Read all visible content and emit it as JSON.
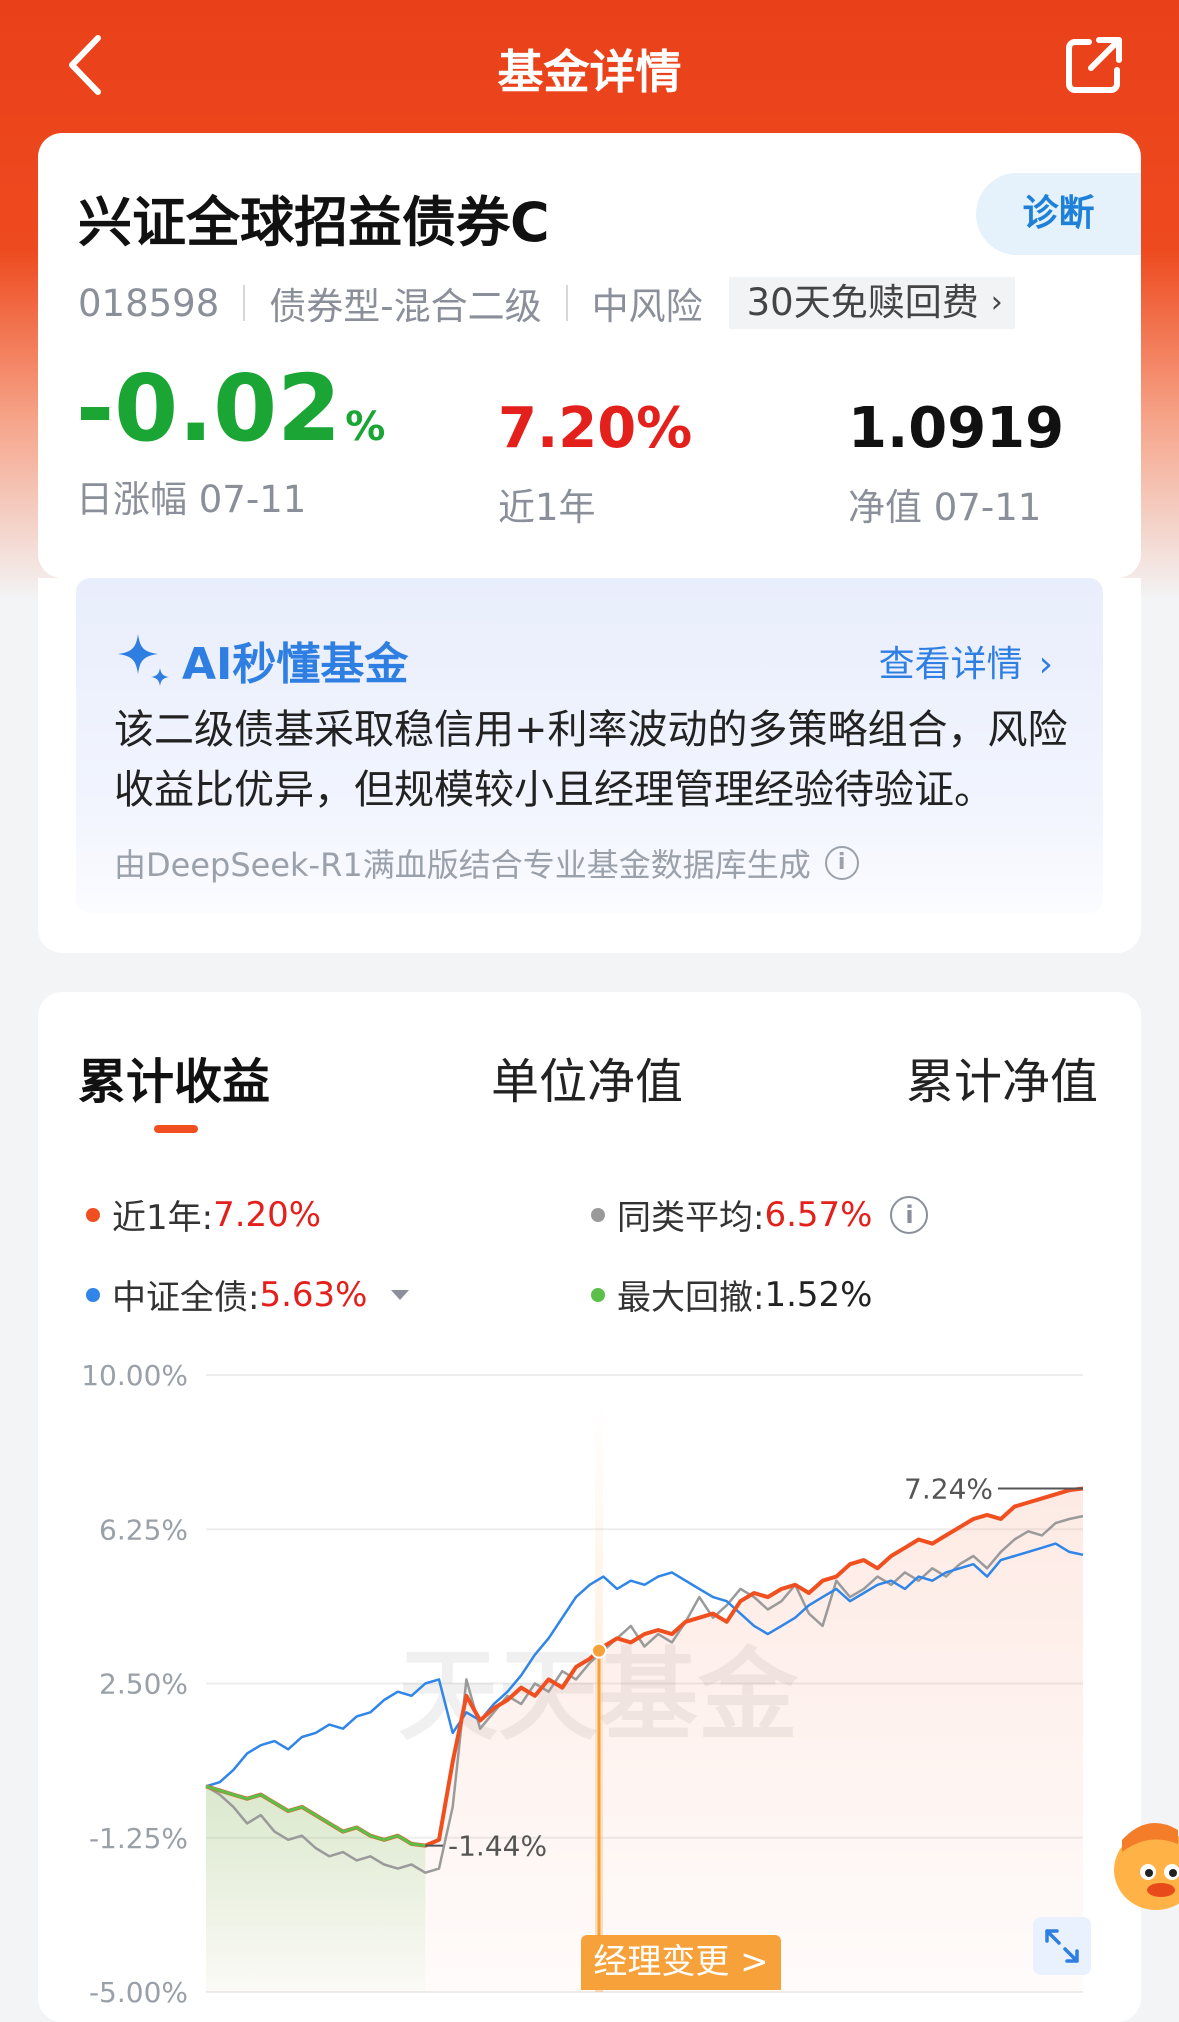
{
  "header": {
    "title": "基金详情",
    "back_icon": "chevron-left-icon",
    "share_icon": "share-icon"
  },
  "fund": {
    "name": "兴证全球招益债券C",
    "code": "018598",
    "type": "债券型-混合二级",
    "risk": "中风险",
    "badge": "30天免赎回费",
    "diagnose": "诊断",
    "daily_change": "-0.02",
    "daily_change_unit": "%",
    "daily_label": "日涨幅 07-11",
    "year_return": "7.20%",
    "year_label": "近1年",
    "nav": "1.0919",
    "nav_label": "净值 07-11"
  },
  "ai": {
    "title": "AI秒懂基金",
    "more": "查看详情",
    "text": "该二级债基采取稳信用+利率波动的多策略组合，风险收益比优异，但规模较小且经理管理经验待验证。",
    "source": "由DeepSeek-R1满血版结合专业基金数据库生成"
  },
  "tabs": [
    {
      "label": "累计收益",
      "active": true
    },
    {
      "label": "单位净值",
      "active": false
    },
    {
      "label": "累计净值",
      "active": false
    }
  ],
  "legend": [
    {
      "label": "近1年:",
      "value": "7.20%",
      "color": "#f0501f"
    },
    {
      "label": "同类平均:",
      "value": "6.57%",
      "color": "#9a9a9a"
    },
    {
      "label": "中证全债:",
      "value": "5.63%",
      "color": "#2f85e8"
    },
    {
      "label": "最大回撤:",
      "value": "1.52%",
      "color": "#5ac04a"
    }
  ],
  "colors": {
    "brand": "#e9401a",
    "up": "#e4201c",
    "down": "#1aa534",
    "accent_blue": "#2f7fe3"
  },
  "chart_data": {
    "type": "line",
    "y_ticks": [
      "10.00%",
      "6.25%",
      "2.50%",
      "-1.25%",
      "-5.00%"
    ],
    "ylim": [
      -5.0,
      10.0
    ],
    "watermark": "天天基金",
    "annotations": [
      {
        "text": "7.24%",
        "y": 7.24
      },
      {
        "text": "-1.44%",
        "y": -1.44
      }
    ],
    "event": {
      "label": "经理变更 >"
    },
    "series": [
      {
        "name": "近1年",
        "color": "#f0501f",
        "values": [
          0,
          -0.1,
          -0.2,
          -0.3,
          -0.2,
          -0.4,
          -0.6,
          -0.5,
          -0.7,
          -0.9,
          -1.1,
          -1.0,
          -1.2,
          -1.3,
          -1.2,
          -1.4,
          -1.44,
          -1.3,
          0.6,
          2.2,
          1.6,
          1.9,
          2.1,
          2.4,
          2.2,
          2.6,
          2.4,
          2.9,
          3.1,
          3.4,
          3.6,
          3.5,
          3.7,
          3.8,
          3.7,
          4.0,
          4.1,
          4.2,
          4.0,
          4.5,
          4.7,
          4.6,
          4.8,
          4.9,
          4.7,
          5.0,
          5.1,
          5.4,
          5.5,
          5.3,
          5.6,
          5.8,
          6.0,
          5.9,
          6.1,
          6.3,
          6.5,
          6.6,
          6.5,
          6.8,
          6.9,
          7.0,
          7.1,
          7.2,
          7.24
        ]
      },
      {
        "name": "同类平均",
        "color": "#9a9a9a",
        "values": [
          0,
          -0.2,
          -0.5,
          -0.9,
          -0.7,
          -1.1,
          -1.3,
          -1.2,
          -1.5,
          -1.7,
          -1.6,
          -1.8,
          -1.7,
          -1.9,
          -2.0,
          -1.9,
          -2.1,
          -2.0,
          -0.5,
          2.6,
          1.4,
          1.8,
          2.2,
          2.0,
          2.5,
          2.3,
          2.8,
          2.6,
          3.0,
          3.3,
          3.6,
          3.9,
          3.4,
          3.7,
          3.5,
          4.0,
          4.6,
          4.1,
          4.4,
          4.8,
          4.6,
          4.3,
          4.5,
          4.9,
          4.2,
          3.9,
          5.0,
          4.6,
          4.8,
          5.1,
          4.9,
          5.2,
          5.0,
          5.3,
          5.1,
          5.4,
          5.6,
          5.3,
          5.7,
          6.0,
          6.2,
          6.1,
          6.4,
          6.5,
          6.57
        ]
      },
      {
        "name": "中证全债",
        "color": "#2f85e8",
        "values": [
          0,
          0.1,
          0.4,
          0.8,
          1.0,
          1.1,
          0.9,
          1.2,
          1.3,
          1.5,
          1.4,
          1.7,
          1.8,
          2.1,
          2.3,
          2.2,
          2.5,
          2.6,
          1.3,
          1.8,
          1.6,
          2.0,
          2.3,
          2.7,
          3.2,
          3.6,
          4.1,
          4.6,
          4.9,
          5.1,
          4.8,
          5.0,
          4.9,
          5.1,
          5.2,
          5.0,
          4.8,
          4.6,
          4.5,
          4.2,
          3.9,
          3.7,
          3.9,
          4.1,
          4.4,
          4.6,
          4.8,
          4.5,
          4.7,
          4.9,
          5.0,
          4.8,
          5.1,
          5.0,
          5.2,
          5.3,
          5.4,
          5.1,
          5.5,
          5.6,
          5.7,
          5.8,
          5.9,
          5.7,
          5.63
        ]
      }
    ]
  }
}
